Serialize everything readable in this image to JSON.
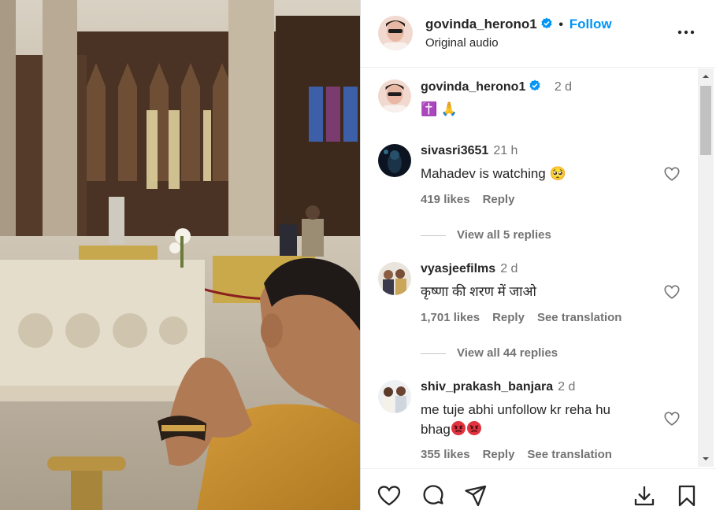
{
  "post": {
    "username": "govinda_herono1",
    "follow_label": "Follow",
    "separator": "•",
    "audio": "Original audio",
    "caption_time": "2 d",
    "caption_emojis": "✝️ 🙏"
  },
  "comments": [
    {
      "username": "sivasri3651",
      "time": "21 h",
      "text": "Mahadev is watching 🥺",
      "likes": "419 likes",
      "reply_label": "Reply",
      "view_replies": "View all 5 replies"
    },
    {
      "username": "vyasjeefilms",
      "time": "2 d",
      "text": "कृष्णा की शरण में जाओ",
      "likes": "1,701 likes",
      "reply_label": "Reply",
      "translation_label": "See translation",
      "view_replies": "View all 44 replies"
    },
    {
      "username": "shiv_prakash_banjara",
      "time": "2 d",
      "text_line1": "me tuje abhi unfollow kr reha hu",
      "text_line2": "bhag",
      "likes": "355 likes",
      "reply_label": "Reply",
      "translation_label": "See translation"
    }
  ],
  "icons": {
    "verified": "verified-badge-icon",
    "more": "more-options-icon",
    "like": "heart-icon",
    "comment": "comment-icon",
    "share": "share-icon",
    "download": "download-icon",
    "save": "bookmark-icon"
  },
  "colors": {
    "accent": "#0095f6",
    "text": "#262626",
    "secondary": "#737373"
  }
}
